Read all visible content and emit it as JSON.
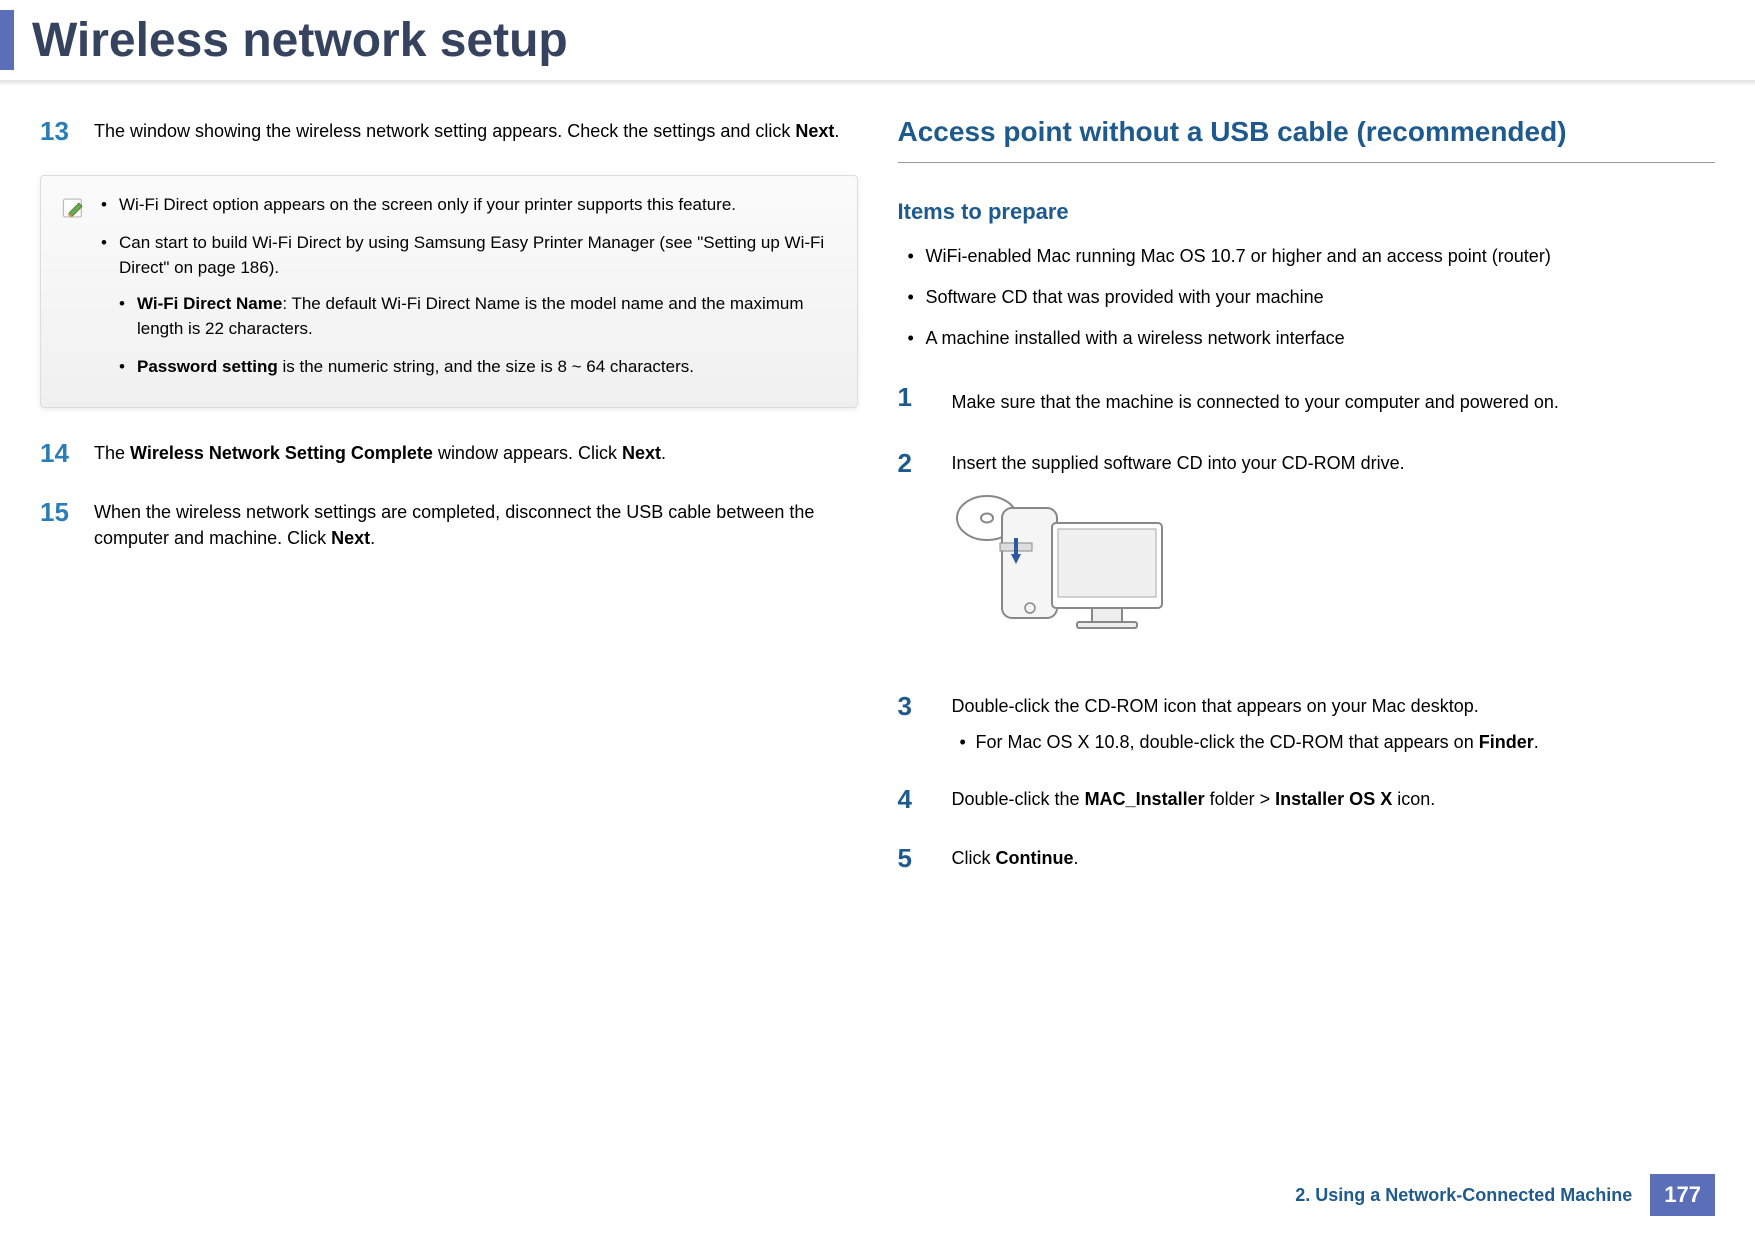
{
  "page_title": "Wireless network setup",
  "left": {
    "step13": {
      "num": "13",
      "text_a": "The window showing the wireless network setting appears. Check the settings and click ",
      "bold_a": "Next",
      "text_b": "."
    },
    "note": {
      "b1": "Wi-Fi Direct option appears on the screen only if your printer supports this feature.",
      "b2_a": "Can start to build Wi-Fi Direct by using Samsung Easy Printer Manager (see \"Setting up Wi-Fi Direct\" on page 186).",
      "b3_bold": "Wi-Fi Direct Name",
      "b3_text": ": The default Wi-Fi Direct Name is the model name and the maximum length is 22 characters.",
      "b4_bold": "Password setting",
      "b4_text": " is the numeric string, and the size is 8 ~ 64 characters."
    },
    "step14": {
      "num": "14",
      "text_a": "The ",
      "bold_a": "Wireless Network Setting Complete",
      "text_b": " window appears. Click ",
      "bold_b": "Next",
      "text_c": "."
    },
    "step15": {
      "num": "15",
      "text_a": "When the wireless network settings are completed, disconnect the USB cable between the computer and machine. Click ",
      "bold_a": "Next",
      "text_b": "."
    }
  },
  "right": {
    "section_heading": "Access point without a USB cable (recommended)",
    "sub_heading": "Items to prepare",
    "prepare": {
      "i1": "WiFi-enabled Mac running Mac OS 10.7 or higher and an access point (router)",
      "i2": "Software CD that was provided with your machine",
      "i3": "A machine installed with a wireless network interface"
    },
    "step1": {
      "num": "1",
      "text": "Make sure that the machine is connected to your computer and powered on."
    },
    "step2": {
      "num": "2",
      "text": "Insert the supplied software CD into your CD-ROM drive."
    },
    "step3": {
      "num": "3",
      "text": "Double-click the CD-ROM icon that appears on your Mac desktop.",
      "sub_a": "For Mac OS X 10.8, double-click the CD-ROM that appears on ",
      "sub_bold": "Finder",
      "sub_b": "."
    },
    "step4": {
      "num": "4",
      "text_a": "Double-click the ",
      "bold_a": "MAC_Installer",
      "text_b": " folder > ",
      "bold_b": "Installer OS X",
      "text_c": " icon."
    },
    "step5": {
      "num": "5",
      "text_a": "Click ",
      "bold_a": "Continue",
      "text_b": "."
    }
  },
  "footer": {
    "chapter": "2.  Using a Network-Connected Machine",
    "page": "177"
  }
}
